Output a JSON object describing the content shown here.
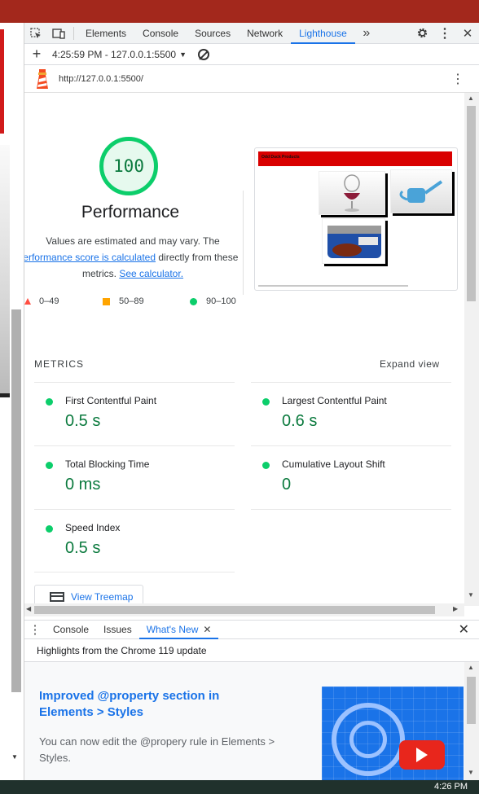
{
  "devtools_tabs": [
    "Elements",
    "Console",
    "Sources",
    "Network",
    "Lighthouse"
  ],
  "active_tab": "Lighthouse",
  "more_tabs_glyph": "»",
  "toolbar": {
    "run_label": "4:25:59 PM - 127.0.0.1:5500"
  },
  "report_url": "http://127.0.0.1:5500/",
  "performance": {
    "score": "100",
    "title": "Performance",
    "note_1": "Values are estimated and may vary. The",
    "note_link": "performance score is calculated",
    "note_2": "directly from these",
    "note_3": "metrics.",
    "calc_link": "See calculator."
  },
  "legend": {
    "fail": "0–49",
    "average": "50–89",
    "pass": "90–100"
  },
  "screenshot_header": "Odd Duck Products",
  "metrics_heading": "METRICS",
  "expand_label": "Expand view",
  "metrics": [
    {
      "name": "First Contentful Paint",
      "value": "0.5 s"
    },
    {
      "name": "Largest Contentful Paint",
      "value": "0.6 s"
    },
    {
      "name": "Total Blocking Time",
      "value": "0 ms"
    },
    {
      "name": "Cumulative Layout Shift",
      "value": "0"
    },
    {
      "name": "Speed Index",
      "value": "0.5 s"
    }
  ],
  "treemap_label": "View Treemap",
  "drawer_tabs": [
    "Console",
    "Issues",
    "What's New"
  ],
  "drawer_subtitle": "Highlights from the Chrome 119 update",
  "news": {
    "title": "Improved @property section in Elements > Styles",
    "description": "You can now edit the @propery rule in Elements > Styles."
  },
  "clock": "4:26 PM",
  "colors": {
    "pass": "#0cce6b",
    "average": "#ffa400",
    "fail": "#ff4e42",
    "accent": "#1a73e8"
  }
}
